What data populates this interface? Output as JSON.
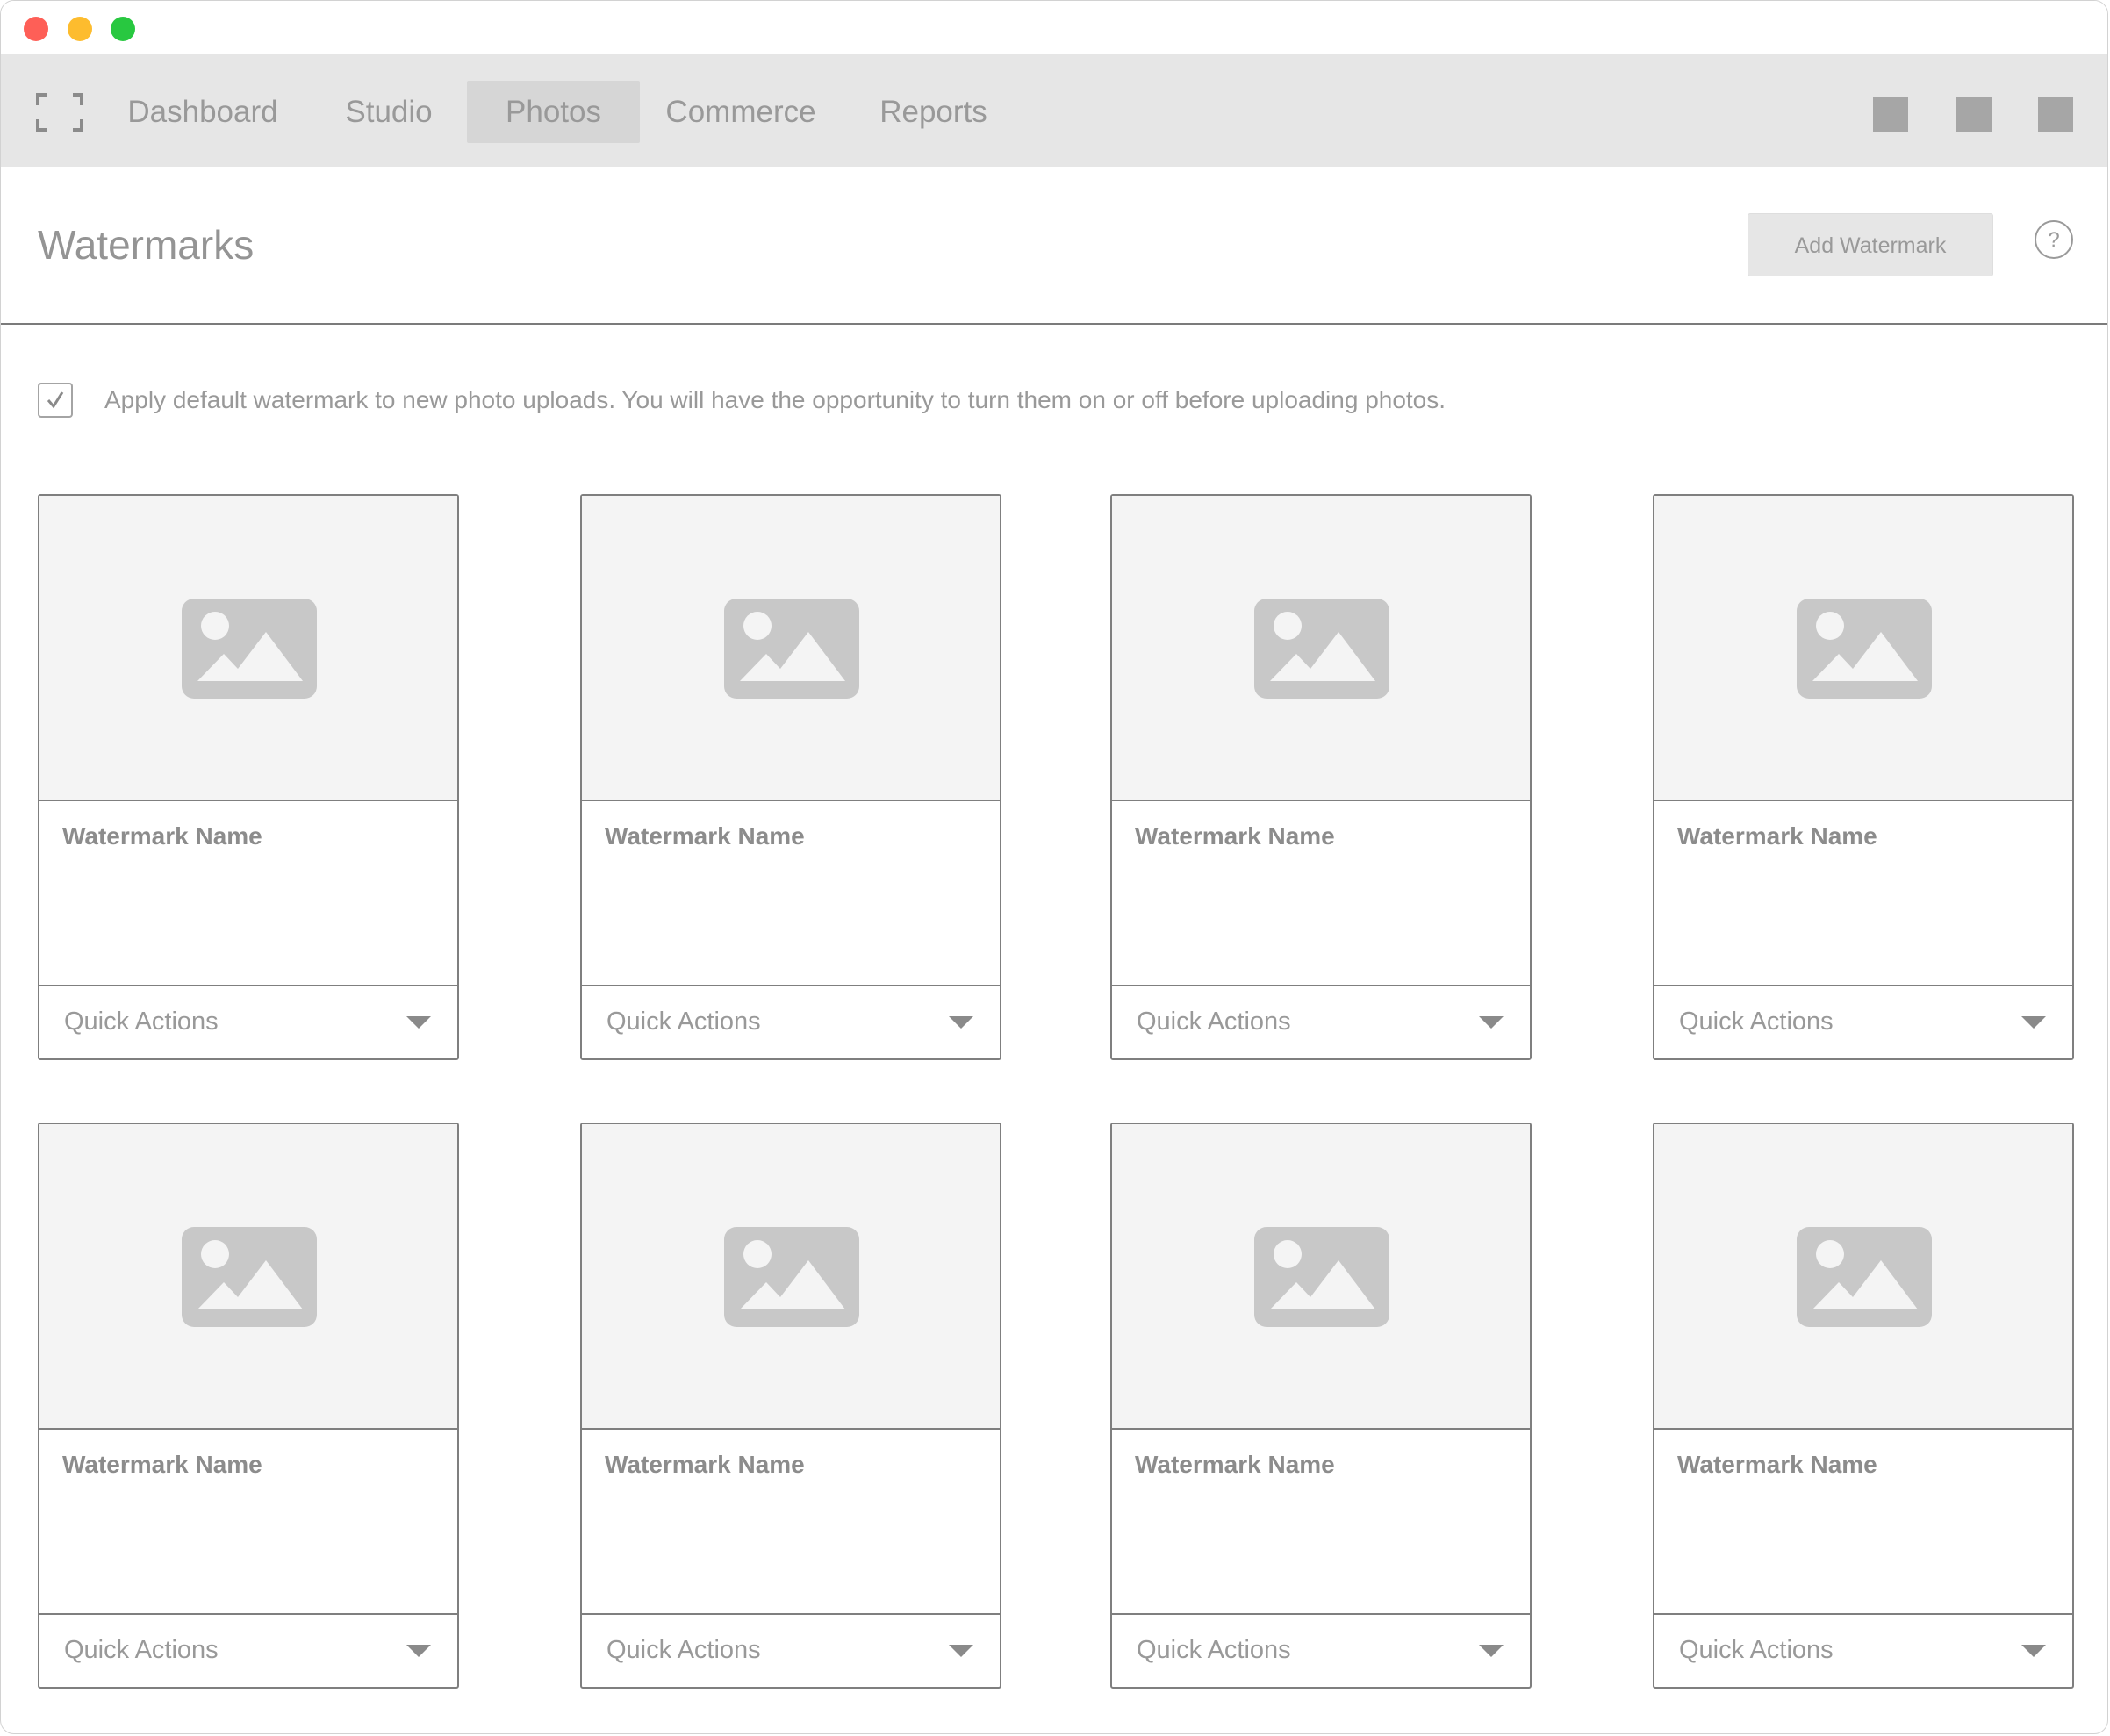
{
  "nav": {
    "tabs": [
      {
        "label": "Dashboard"
      },
      {
        "label": "Studio"
      },
      {
        "label": "Photos",
        "active": true
      },
      {
        "label": "Commerce"
      },
      {
        "label": "Reports"
      }
    ]
  },
  "page": {
    "title": "Watermarks",
    "add_button_label": "Add Watermark",
    "help_label": "?"
  },
  "settings": {
    "apply_default_label": "Apply default watermark to new photo uploads. You will have the opportunity to turn them on or off before uploading photos.",
    "apply_default_checked": true
  },
  "watermarks": [
    {
      "name": "Watermark Name",
      "actions_label": "Quick Actions"
    },
    {
      "name": "Watermark Name",
      "actions_label": "Quick Actions"
    },
    {
      "name": "Watermark Name",
      "actions_label": "Quick Actions"
    },
    {
      "name": "Watermark Name",
      "actions_label": "Quick Actions"
    },
    {
      "name": "Watermark Name",
      "actions_label": "Quick Actions"
    },
    {
      "name": "Watermark Name",
      "actions_label": "Quick Actions"
    },
    {
      "name": "Watermark Name",
      "actions_label": "Quick Actions"
    },
    {
      "name": "Watermark Name",
      "actions_label": "Quick Actions"
    }
  ],
  "colors": {
    "close": "#fe5f57",
    "minimize": "#fdbc2e",
    "maximize": "#28c840",
    "nav_background": "#e6e6e6",
    "active_tab_background": "#d6d6d6"
  },
  "icons": {
    "fullscreen": "fullscreen-icon",
    "image_placeholder": "image-placeholder-icon",
    "help": "help-icon",
    "dropdown": "chevron-down-icon"
  }
}
